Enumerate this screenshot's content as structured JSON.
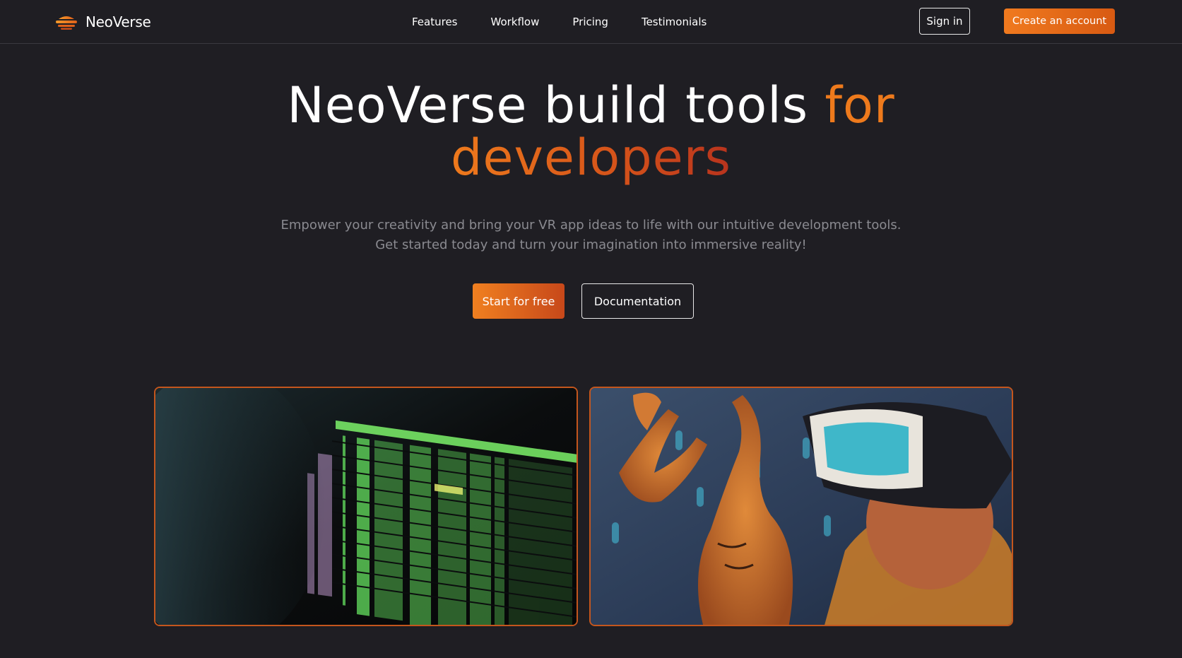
{
  "brand": {
    "name": "NeoVerse",
    "logo_icon": "stacked-layers-logo-icon",
    "accent_color": "#f07a1f"
  },
  "nav": {
    "links": [
      "Features",
      "Workflow",
      "Pricing",
      "Testimonials"
    ],
    "sign_in_label": "Sign in",
    "create_account_label": "Create an account"
  },
  "hero": {
    "title_part1": "NeoVerse build tools ",
    "title_part2": "for",
    "title_part3": "developers",
    "subtitle_line1": "Empower your creativity and bring your VR app ideas to life with our intuitive development tools.",
    "subtitle_line2": "Get started today and turn your imagination into immersive reality!",
    "primary_cta": "Start for free",
    "secondary_cta": "Documentation"
  },
  "images": [
    {
      "name": "terminal-screen-image"
    },
    {
      "name": "vr-headset-person-image"
    }
  ]
}
